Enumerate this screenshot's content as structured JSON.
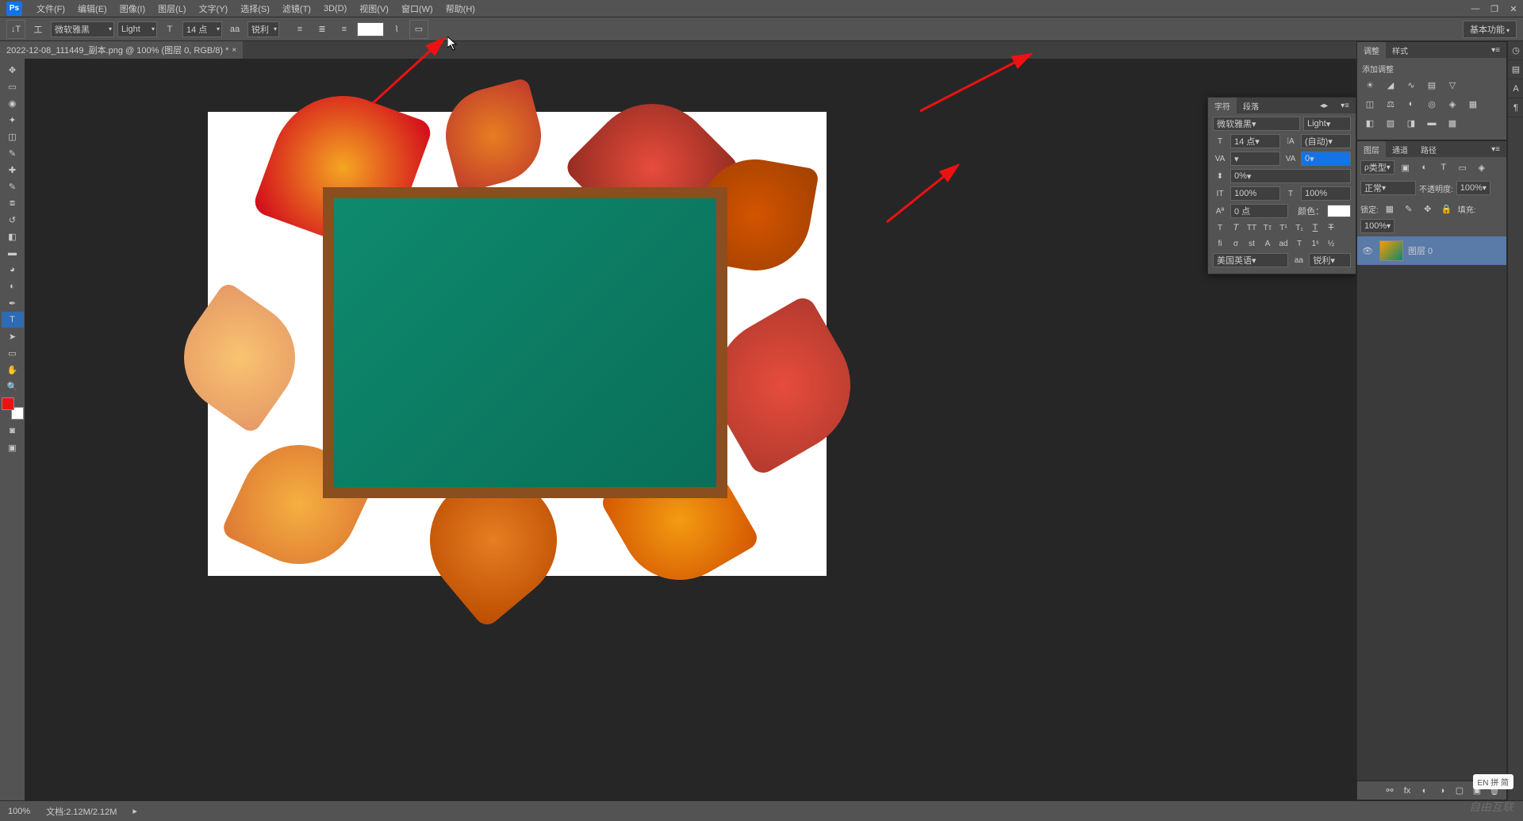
{
  "app": {
    "logo": "Ps"
  },
  "menu": {
    "file": "文件(F)",
    "edit": "编辑(E)",
    "image": "图像(I)",
    "layer": "图层(L)",
    "type": "文字(Y)",
    "select": "选择(S)",
    "filter": "滤镜(T)",
    "d3": "3D(D)",
    "view": "视图(V)",
    "window": "窗口(W)",
    "help": "帮助(H)"
  },
  "optbar": {
    "font": "微软雅黑",
    "style": "Light",
    "size": "14 点",
    "aa": "锐利",
    "essentials": "基本功能"
  },
  "tab": {
    "title": "2022-12-08_111449_副本.png @ 100% (图层 0, RGB/8) *"
  },
  "char": {
    "tab_char": "字符",
    "tab_para": "段落",
    "font": "微软雅黑",
    "style": "Light",
    "size": "14 点",
    "leading": "(自动)",
    "tracking": "0",
    "vscale": "0%",
    "hscale": "100%",
    "baseline": "0 点",
    "h100": "100%",
    "color_label": "颜色：",
    "lang": "美国英语",
    "aa": "锐利"
  },
  "adj": {
    "tab_adj": "调整",
    "tab_style": "样式",
    "add": "添加调整"
  },
  "layers": {
    "tab_layers": "图层",
    "tab_channels": "通道",
    "tab_paths": "路径",
    "kind": "类型",
    "blend": "正常",
    "opacity_label": "不透明度:",
    "opacity": "100%",
    "lock_label": "锁定:",
    "fill_label": "填充:",
    "fill": "100%",
    "layer0": "图层 0"
  },
  "status": {
    "zoom": "100%",
    "doc": "文档:2.12M/2.12M"
  },
  "ime": "EN 拼 简",
  "watermark": "自由互联"
}
